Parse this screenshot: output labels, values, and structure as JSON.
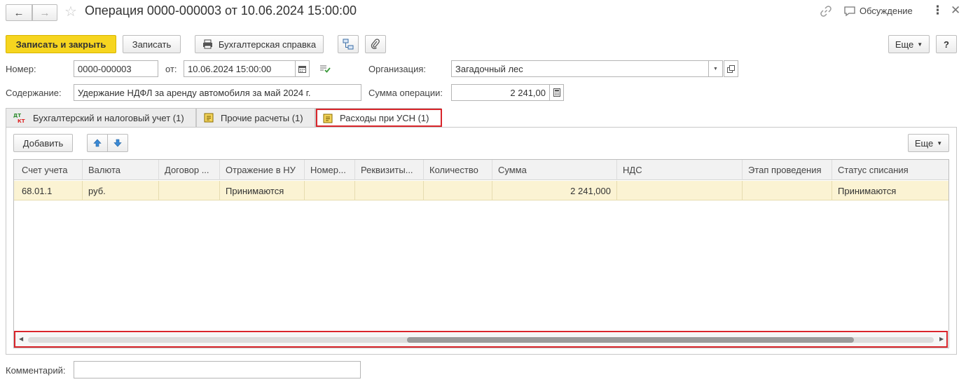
{
  "window": {
    "title": "Операция 0000-000003 от 10.06.2024 15:00:00",
    "discussion_label": "Обсуждение"
  },
  "toolbar": {
    "save_close_label": "Записать и закрыть",
    "save_label": "Записать",
    "accounting_ref_label": "Бухгалтерская справка",
    "more_label": "Еще",
    "help_label": "?"
  },
  "form": {
    "number_label": "Номер:",
    "number_value": "0000-000003",
    "date_label": "от:",
    "date_value": "10.06.2024 15:00:00",
    "org_label": "Организация:",
    "org_value": "Загадочный лес",
    "content_label": "Содержание:",
    "content_value": "Удержание НДФЛ за аренду автомобиля за май 2024 г.",
    "amount_label": "Сумма операции:",
    "amount_value": "2 241,00",
    "comment_label": "Комментарий:",
    "comment_value": ""
  },
  "tabs": [
    {
      "label": "Бухгалтерский и налоговый учет (1)",
      "icon": "dt-kt-icon"
    },
    {
      "label": "Прочие расчеты (1)",
      "icon": "ledger-icon"
    },
    {
      "label": "Расходы при УСН (1)",
      "icon": "ledger-icon",
      "active": true
    }
  ],
  "table_toolbar": {
    "add_label": "Добавить",
    "more_label": "Еще"
  },
  "table": {
    "columns": [
      "Счет учета",
      "Валюта",
      "Договор ...",
      "Отражение в НУ",
      "Номер...",
      "Реквизиты...",
      "Количество",
      "Сумма",
      "НДС",
      "Этап проведения",
      "Статус списания"
    ],
    "rows": [
      [
        "68.01.1",
        "руб.",
        "",
        "Принимаются",
        "",
        "",
        "",
        "2 241,000",
        "",
        "",
        "Принимаются"
      ]
    ]
  },
  "colors": {
    "accent_yellow": "#f6d51f",
    "selected_row": "#fbf3d3",
    "highlight_red": "#d9252b"
  }
}
